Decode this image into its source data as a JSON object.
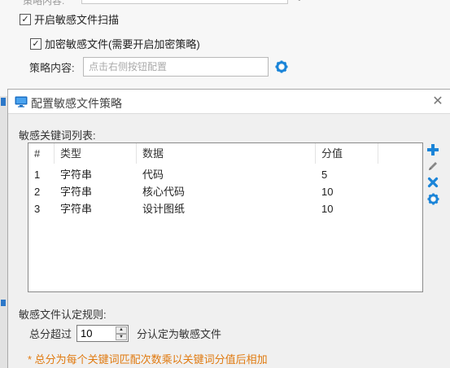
{
  "background": {
    "cut_label": "策略内容:",
    "enable_scan_label": "开启敏感文件扫描",
    "enable_scan_checked": true,
    "encrypt_label": "加密敏感文件(需要开启加密策略)",
    "encrypt_checked": true,
    "policy_label": "策略内容:",
    "policy_placeholder": "点击右侧按钮配置",
    "colors": {
      "accent": "#1a84d8"
    }
  },
  "dialog": {
    "title": "配置敏感文件策略",
    "keyword_list_label": "敏感关键词列表:",
    "table": {
      "headers": [
        "#",
        "类型",
        "数据",
        "分值"
      ],
      "rows": [
        [
          "1",
          "字符串",
          "代码",
          "5"
        ],
        [
          "2",
          "字符串",
          "核心代码",
          "10"
        ],
        [
          "3",
          "字符串",
          "设计图纸",
          "10"
        ]
      ]
    },
    "tools": [
      "plus-icon",
      "pencil-icon",
      "delete-x-icon",
      "gear-icon"
    ],
    "rule_label": "敏感文件认定规则:",
    "score": {
      "prefix": "总分超过",
      "value": "10",
      "suffix": "分认定为敏感文件"
    },
    "note": "* 总分为每个关键词匹配次数乘以关键词分值后相加",
    "colors": {
      "note": "#e07a10",
      "accent": "#1a84d8"
    }
  }
}
